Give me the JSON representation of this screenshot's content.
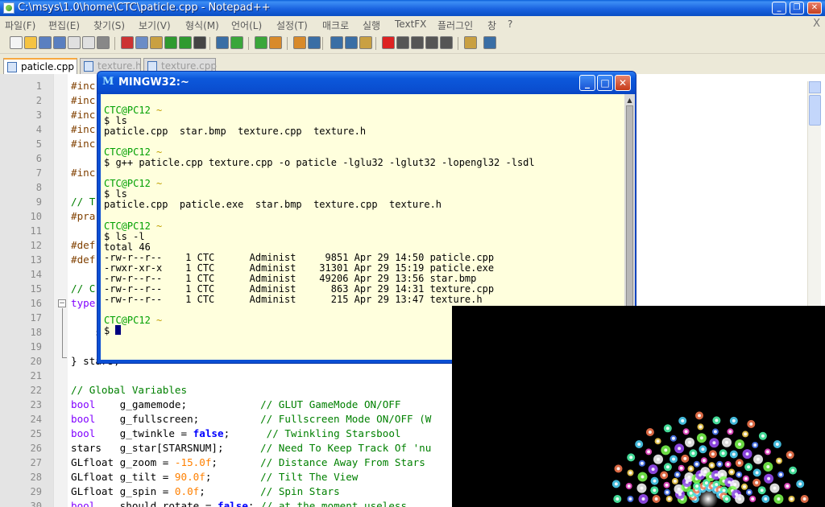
{
  "notepad": {
    "title": "C:\\msys\\1.0\\home\\CTC\\paticle.cpp - Notepad++",
    "menu": [
      "파일(F)",
      "편집(E)",
      "찾기(S)",
      "보기(V)",
      "형식(M)",
      "언어(L)",
      "설정(T)",
      "매크로",
      "실행",
      "TextFX",
      "플러그인",
      "창",
      "?"
    ],
    "menu_close": "X",
    "tabs": [
      "paticle.cpp",
      "texture.h",
      "texture.cpp"
    ],
    "active_tab": "paticle.cpp"
  },
  "editor": {
    "line_numbers": [
      "1",
      "2",
      "3",
      "4",
      "5",
      "6",
      "7",
      "8",
      "9",
      "10",
      "11",
      "12",
      "13",
      "14",
      "15",
      "16",
      "17",
      "18",
      "19",
      "20",
      "21",
      "22",
      "23",
      "24",
      "25",
      "26",
      "27",
      "28",
      "29",
      "30"
    ],
    "code_lines": [
      [
        "#inc"
      ],
      [
        "#inc"
      ],
      [
        "#inc"
      ],
      [
        "#inc"
      ],
      [
        "#inc"
      ],
      [
        ""
      ],
      [
        "#inc"
      ],
      [
        ""
      ],
      [
        "// T"
      ],
      [
        "#pra"
      ],
      [
        ""
      ],
      [
        "#def"
      ],
      [
        "#def"
      ],
      [
        ""
      ],
      [
        "// C"
      ],
      [
        "type"
      ],
      [
        ""
      ],
      [
        "    s"
      ],
      [
        ""
      ],
      [
        "} stars;"
      ],
      [
        ""
      ],
      [
        "// Global Variables"
      ],
      [
        "bool",
        "    g_gamemode;            ",
        "// GLUT GameMode ON/OFF"
      ],
      [
        "bool",
        "    g_fullscreen;          ",
        "// Fullscreen Mode ON/OFF (W"
      ],
      [
        "bool",
        "    g_twinkle = ",
        "false",
        ";      ",
        "// Twinkling Starsbool"
      ],
      [
        "stars   g_star[STARSNUM];      ",
        "// Need To Keep Track Of 'nu"
      ],
      [
        "GLfloat g_zoom = ",
        "-15.0f",
        ";       ",
        "// Distance Away From Stars"
      ],
      [
        "GLfloat g_tilt = ",
        "90.0f",
        ";        ",
        "// Tilt The View"
      ],
      [
        "GLfloat g_spin = ",
        "0.0f",
        ";         ",
        "// Spin Stars"
      ],
      [
        "bool",
        "    should_rotate = ",
        "false",
        "; ",
        "// at the moment useless"
      ]
    ]
  },
  "terminal": {
    "title": "MINGW32:~",
    "prompt_user": "CTC@PC12",
    "prompt_tilde": "~",
    "lines": [
      {
        "kind": "prompt"
      },
      {
        "kind": "cmd",
        "text": "$ ls"
      },
      {
        "kind": "out",
        "text": "paticle.cpp  star.bmp  texture.cpp  texture.h"
      },
      {
        "kind": "blank"
      },
      {
        "kind": "prompt"
      },
      {
        "kind": "cmd",
        "text": "$ g++ paticle.cpp texture.cpp -o paticle -lglu32 -lglut32 -lopengl32 -lsdl"
      },
      {
        "kind": "blank"
      },
      {
        "kind": "prompt"
      },
      {
        "kind": "cmd",
        "text": "$ ls"
      },
      {
        "kind": "out",
        "text": "paticle.cpp  paticle.exe  star.bmp  texture.cpp  texture.h"
      },
      {
        "kind": "blank"
      },
      {
        "kind": "prompt"
      },
      {
        "kind": "cmd",
        "text": "$ ls -l"
      },
      {
        "kind": "out",
        "text": "total 46"
      },
      {
        "kind": "out",
        "text": "-rw-r--r--    1 CTC      Administ     9851 Apr 29 14:50 paticle.cpp"
      },
      {
        "kind": "out",
        "text": "-rwxr-xr-x    1 CTC      Administ    31301 Apr 29 15:19 paticle.exe"
      },
      {
        "kind": "out",
        "text": "-rw-r--r--    1 CTC      Administ    49206 Apr 29 13:56 star.bmp"
      },
      {
        "kind": "out",
        "text": "-rw-r--r--    1 CTC      Administ      863 Apr 29 14:31 texture.cpp"
      },
      {
        "kind": "out",
        "text": "-rw-r--r--    1 CTC      Administ      215 Apr 29 13:47 texture.h"
      },
      {
        "kind": "blank"
      },
      {
        "kind": "prompt"
      },
      {
        "kind": "cursor",
        "text": "$ "
      }
    ]
  },
  "colors": {
    "xp_title": "#0a4fd0",
    "terminal_bg": "#ffffdd",
    "prompt_green": "#00a000",
    "keyword_purple": "#8000ff",
    "comment_green": "#008000",
    "number_orange": "#ff8000",
    "gl_background": "#000000"
  },
  "icons": {
    "toolbar": [
      "new-file-icon",
      "open-file-icon",
      "save-icon",
      "save-all-icon",
      "close-icon",
      "close-all-icon",
      "print-icon",
      "cut-icon",
      "copy-icon",
      "paste-icon",
      "undo-icon",
      "redo-icon",
      "find-icon",
      "replace-icon",
      "zoom-in-icon",
      "zoom-out-icon",
      "sync-v-icon",
      "sync-h-icon",
      "word-wrap-icon",
      "show-all-chars-icon",
      "indent-guide-icon",
      "user-lang-icon",
      "record-macro-icon",
      "stop-macro-icon",
      "play-macro-icon",
      "run-macro-multiple-icon",
      "save-macro-icon",
      "trim-icon",
      "spellcheck-icon"
    ]
  }
}
